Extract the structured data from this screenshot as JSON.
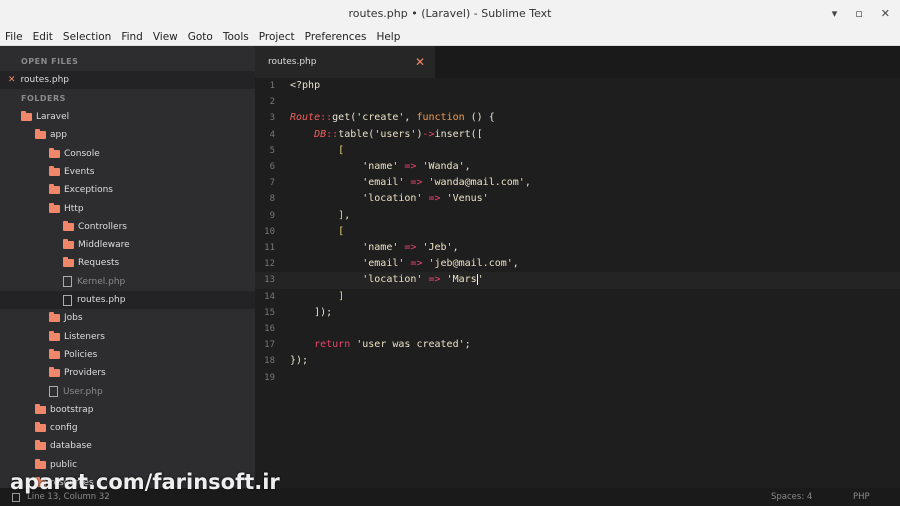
{
  "window": {
    "title": "routes.php • (Laravel) - Sublime Text",
    "controls": [
      "▾",
      "▫",
      "✕"
    ]
  },
  "menu": [
    "File",
    "Edit",
    "Selection",
    "Find",
    "View",
    "Goto",
    "Tools",
    "Project",
    "Preferences",
    "Help"
  ],
  "sidebar": {
    "open_files_label": "OPEN FILES",
    "open_files": [
      "routes.php"
    ],
    "folders_label": "FOLDERS",
    "tree": [
      {
        "type": "folder",
        "name": "Laravel",
        "depth": 0
      },
      {
        "type": "folder",
        "name": "app",
        "depth": 1
      },
      {
        "type": "folder",
        "name": "Console",
        "depth": 2
      },
      {
        "type": "folder",
        "name": "Events",
        "depth": 2
      },
      {
        "type": "folder",
        "name": "Exceptions",
        "depth": 2
      },
      {
        "type": "folder",
        "name": "Http",
        "depth": 2
      },
      {
        "type": "folder",
        "name": "Controllers",
        "depth": 3
      },
      {
        "type": "folder",
        "name": "Middleware",
        "depth": 3
      },
      {
        "type": "folder",
        "name": "Requests",
        "depth": 3
      },
      {
        "type": "file",
        "name": "Kernel.php",
        "depth": 3
      },
      {
        "type": "file",
        "name": "routes.php",
        "depth": 3,
        "selected": true
      },
      {
        "type": "folder",
        "name": "Jobs",
        "depth": 2
      },
      {
        "type": "folder",
        "name": "Listeners",
        "depth": 2
      },
      {
        "type": "folder",
        "name": "Policies",
        "depth": 2
      },
      {
        "type": "folder",
        "name": "Providers",
        "depth": 2
      },
      {
        "type": "file",
        "name": "User.php",
        "depth": 2
      },
      {
        "type": "folder",
        "name": "bootstrap",
        "depth": 1
      },
      {
        "type": "folder",
        "name": "config",
        "depth": 1
      },
      {
        "type": "folder",
        "name": "database",
        "depth": 1
      },
      {
        "type": "folder",
        "name": "public",
        "depth": 1
      },
      {
        "type": "folder",
        "name": "resources",
        "depth": 1
      }
    ]
  },
  "tab": {
    "label": "routes.php",
    "close": "✕"
  },
  "editor": {
    "current_line": 13,
    "lines": [
      [
        [
          "p",
          "<?php"
        ]
      ],
      [],
      [
        [
          "cls",
          "Route"
        ],
        [
          "op",
          "::"
        ],
        [
          "p",
          "get("
        ],
        [
          "str",
          "'create'"
        ],
        [
          "p",
          ", "
        ],
        [
          "kw",
          "function"
        ],
        [
          "p",
          " () {"
        ]
      ],
      [
        [
          "p",
          "    "
        ],
        [
          "cls",
          "DB"
        ],
        [
          "op",
          "::"
        ],
        [
          "p",
          "table("
        ],
        [
          "str",
          "'users'"
        ],
        [
          "p",
          ")"
        ],
        [
          "op",
          "->"
        ],
        [
          "p",
          "insert(["
        ]
      ],
      [
        [
          "p",
          "        "
        ],
        [
          "br",
          "["
        ]
      ],
      [
        [
          "p",
          "            "
        ],
        [
          "str",
          "'name'"
        ],
        [
          "op",
          " => "
        ],
        [
          "str",
          "'Wanda'"
        ],
        [
          "p",
          ","
        ]
      ],
      [
        [
          "p",
          "            "
        ],
        [
          "str",
          "'email'"
        ],
        [
          "op",
          " => "
        ],
        [
          "str",
          "'wanda@mail.com'"
        ],
        [
          "p",
          ","
        ]
      ],
      [
        [
          "p",
          "            "
        ],
        [
          "str",
          "'location'"
        ],
        [
          "op",
          " => "
        ],
        [
          "str",
          "'Venus'"
        ]
      ],
      [
        [
          "p",
          "        "
        ],
        [
          "br",
          "]"
        ],
        [
          "p",
          ","
        ]
      ],
      [
        [
          "p",
          "        "
        ],
        [
          "br",
          "["
        ]
      ],
      [
        [
          "p",
          "            "
        ],
        [
          "str",
          "'name'"
        ],
        [
          "op",
          " => "
        ],
        [
          "str",
          "'Jeb'"
        ],
        [
          "p",
          ","
        ]
      ],
      [
        [
          "p",
          "            "
        ],
        [
          "str",
          "'email'"
        ],
        [
          "op",
          " => "
        ],
        [
          "str",
          "'jeb@mail.com'"
        ],
        [
          "p",
          ","
        ]
      ],
      [
        [
          "p",
          "            "
        ],
        [
          "str",
          "'location'"
        ],
        [
          "op",
          " => "
        ],
        [
          "str",
          "'Mars"
        ],
        [
          "caret",
          ""
        ],
        [
          "str",
          "'"
        ]
      ],
      [
        [
          "p",
          "        "
        ],
        [
          "br",
          "]"
        ]
      ],
      [
        [
          "p",
          "    ]);"
        ]
      ],
      [],
      [
        [
          "p",
          "    "
        ],
        [
          "ret",
          "return"
        ],
        [
          "p",
          " "
        ],
        [
          "str",
          "'user was created'"
        ],
        [
          "p",
          ";"
        ]
      ],
      [
        [
          "p",
          "});"
        ]
      ],
      []
    ]
  },
  "status": {
    "position": "Line 13, Column 32",
    "spaces": "Spaces: 4",
    "syntax": "PHP"
  },
  "watermark": "aparat.com/farinsoft.ir"
}
